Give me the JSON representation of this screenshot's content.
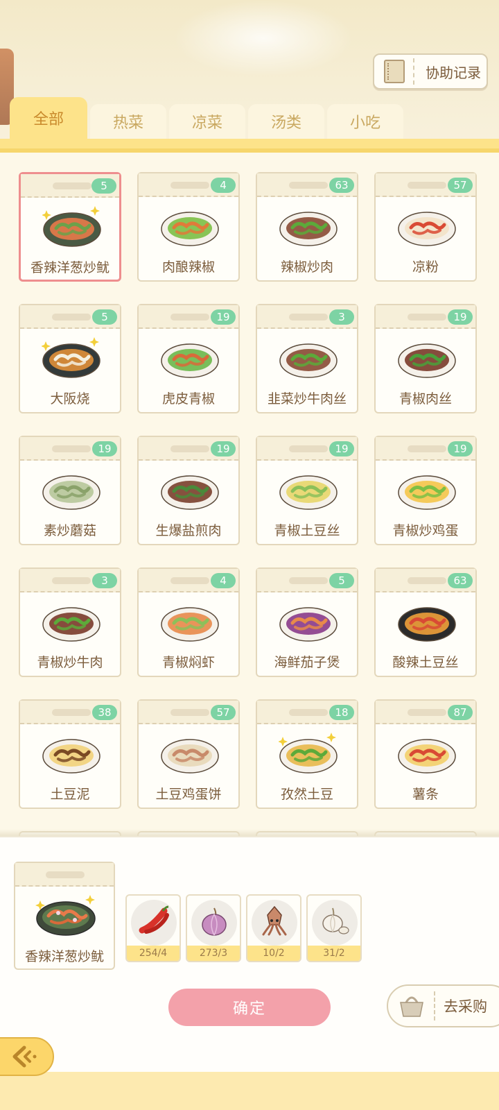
{
  "header": {
    "assist_label": "协助记录"
  },
  "tabs": [
    {
      "label": "全部",
      "active": true
    },
    {
      "label": "热菜",
      "active": false
    },
    {
      "label": "凉菜",
      "active": false
    },
    {
      "label": "汤类",
      "active": false
    },
    {
      "label": "小吃",
      "active": false
    }
  ],
  "dishes": [
    {
      "name": "香辣洋葱炒鱿",
      "count": "5",
      "selected": true
    },
    {
      "name": "肉酿辣椒",
      "count": "4"
    },
    {
      "name": "辣椒炒肉",
      "count": "63"
    },
    {
      "name": "凉粉",
      "count": "57"
    },
    {
      "name": "大阪烧",
      "count": "5"
    },
    {
      "name": "虎皮青椒",
      "count": "19"
    },
    {
      "name": "韭菜炒牛肉丝",
      "count": "3"
    },
    {
      "name": "青椒肉丝",
      "count": "19"
    },
    {
      "name": "素炒蘑菇",
      "count": "19"
    },
    {
      "name": "生爆盐煎肉",
      "count": "19"
    },
    {
      "name": "青椒土豆丝",
      "count": "19"
    },
    {
      "name": "青椒炒鸡蛋",
      "count": "19"
    },
    {
      "name": "青椒炒牛肉",
      "count": "3"
    },
    {
      "name": "青椒焖虾",
      "count": "4"
    },
    {
      "name": "海鲜茄子煲",
      "count": "5"
    },
    {
      "name": "酸辣土豆丝",
      "count": "63"
    },
    {
      "name": "土豆泥",
      "count": "38"
    },
    {
      "name": "土豆鸡蛋饼",
      "count": "57"
    },
    {
      "name": "孜然土豆",
      "count": "18"
    },
    {
      "name": "薯条",
      "count": "87"
    }
  ],
  "selected": {
    "name": "香辣洋葱炒鱿",
    "ingredients": [
      {
        "icon": "chili-icon",
        "qty": "254/4"
      },
      {
        "icon": "onion-icon",
        "qty": "273/3"
      },
      {
        "icon": "squid-icon",
        "qty": "10/2"
      },
      {
        "icon": "garlic-icon",
        "qty": "31/2"
      }
    ]
  },
  "actions": {
    "confirm": "确定",
    "purchase": "去采购"
  }
}
